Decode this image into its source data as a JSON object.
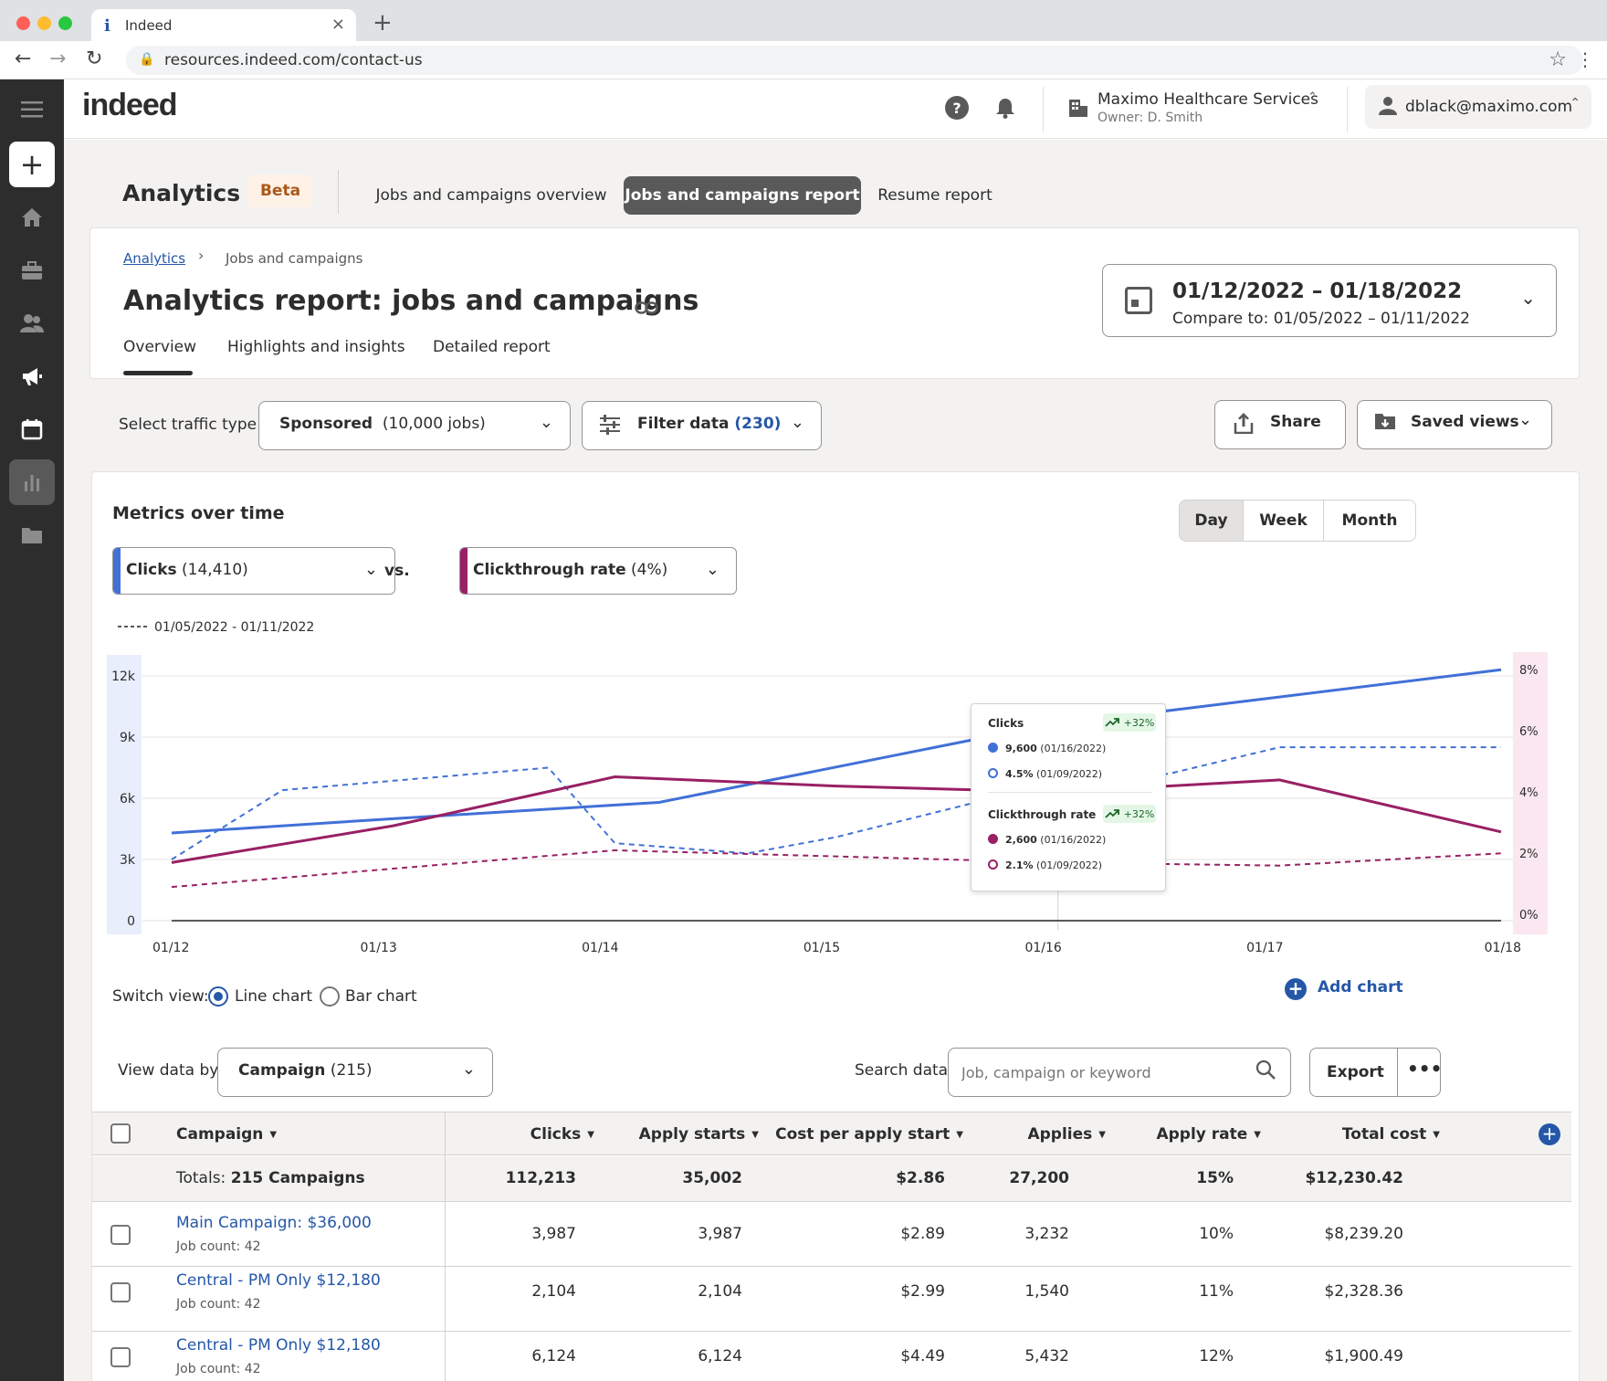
{
  "browser": {
    "tab_title": "Indeed",
    "url": "resources.indeed.com/contact-us"
  },
  "header": {
    "logo": "indeed",
    "company_name": "Maximo Healthcare Services",
    "company_owner": "Owner: D. Smith",
    "user_email": "dblack@maximo.com"
  },
  "analytics_nav": {
    "title": "Analytics",
    "badge": "Beta",
    "tabs": [
      "Jobs and campaigns overview",
      "Jobs and campaigns report",
      "Resume report"
    ],
    "active_tab": "Jobs and campaigns report"
  },
  "report": {
    "breadcrumb_root": "Analytics",
    "breadcrumb_current": "Jobs and campaigns",
    "title": "Analytics report: jobs and campaigns",
    "subtabs": [
      "Overview",
      "Highlights and insights",
      "Detailed report"
    ],
    "active_subtab": "Overview",
    "date_range": "01/12/2022 – 01/18/2022",
    "compare_to": "Compare to: 01/05/2022 – 01/11/2022"
  },
  "filters": {
    "traffic_label": "Select traffic type:",
    "traffic_value": "Sponsored",
    "traffic_count": "(10,000 jobs)",
    "filter_label": "Filter data",
    "filter_count": "(230)",
    "share_label": "Share",
    "saved_views_label": "Saved views"
  },
  "metrics": {
    "title": "Metrics over time",
    "periods": [
      "Day",
      "Week",
      "Month"
    ],
    "selected_period": "Day",
    "metric_a": "Clicks",
    "metric_a_count": "(14,410)",
    "vs_label": "vs.",
    "metric_b": "Clickthrough rate",
    "metric_b_count": "(4%)",
    "compare_legend": "01/05/2022 - 01/11/2022",
    "colors": {
      "clicks": "#4170d7",
      "ctr": "#982065",
      "left_band": "#e8eefb",
      "right_band": "#fbe7f0"
    }
  },
  "tooltip": {
    "clicks_title": "Clicks",
    "clicks_badge": "+32%",
    "clicks_current_value": "9,600",
    "clicks_current_date": "(01/16/2022)",
    "clicks_prev_value": "4.5%",
    "clicks_prev_date": "(01/09/2022)",
    "ctr_title": "Clickthrough rate",
    "ctr_badge": "+32%",
    "ctr_current_value": "2,600",
    "ctr_current_date": "(01/16/2022)",
    "ctr_prev_value": "2.1%",
    "ctr_prev_date": "(01/09/2022)"
  },
  "chart_data": {
    "type": "line",
    "x": [
      "01/12",
      "01/13",
      "01/14",
      "01/15",
      "01/16",
      "01/17",
      "01/18"
    ],
    "y_left_ticks": [
      "12k",
      "9k",
      "6k",
      "3k",
      "0"
    ],
    "y_right_ticks": [
      "8%",
      "6%",
      "4%",
      "2%",
      "0%"
    ],
    "ylim_left": [
      0,
      12000
    ],
    "ylim_right": [
      0,
      8
    ],
    "series": [
      {
        "name": "Clicks",
        "axis": "left",
        "style": "solid",
        "x": [
          0,
          1,
          2.2,
          4,
          4.5,
          6
        ],
        "values": [
          4300,
          5000,
          5800,
          9700,
          10300,
          12300
        ]
      },
      {
        "name": "Clicks",
        "axis": "left",
        "style": "dashed",
        "x": [
          0,
          0.5,
          1.7,
          2,
          2.6,
          3,
          4,
          4.5,
          5,
          6
        ],
        "values": [
          3000,
          6400,
          7500,
          3800,
          3300,
          4100,
          6800,
          7200,
          8500,
          8500
        ]
      },
      {
        "name": "Clickthrough rate",
        "axis": "right",
        "style": "solid",
        "x": [
          0,
          1,
          2,
          3,
          4,
          5,
          6
        ],
        "values": [
          1.9,
          3.1,
          4.7,
          4.4,
          4.2,
          4.6,
          2.9
        ]
      },
      {
        "name": "Clickthrough rate",
        "axis": "right",
        "style": "dashed",
        "x": [
          0,
          1,
          2,
          3,
          4,
          5,
          6
        ],
        "values": [
          1.1,
          1.7,
          2.3,
          2.1,
          1.9,
          1.8,
          2.2
        ]
      },
      {
        "name": "",
        "axis": "left",
        "style": "solid-gray",
        "x": [
          0,
          6
        ],
        "values": [
          0,
          0
        ]
      }
    ],
    "grid": true,
    "hover_x_index": 4
  },
  "view_controls": {
    "switch_label": "Switch view:",
    "line_chart": "Line chart",
    "bar_chart": "Bar chart",
    "selected_view": "Line chart",
    "add_chart": "Add chart",
    "view_by_label": "View data by:",
    "view_by_value": "Campaign",
    "view_by_count": "(215)",
    "search_label": "Search data:",
    "search_placeholder": "Job, campaign or keyword",
    "export_label": "Export"
  },
  "table": {
    "columns": [
      "Campaign",
      "Clicks",
      "Apply starts",
      "Cost per apply start",
      "Applies",
      "Apply rate",
      "Total cost"
    ],
    "totals_label": "Totals:",
    "totals_campaigns": "215 Campaigns",
    "totals": [
      "112,213",
      "35,002",
      "$2.86",
      "27,200",
      "15%",
      "$12,230.42"
    ],
    "rows": [
      {
        "name": "Main Campaign: $36,000",
        "job_count": "Job count: 42",
        "values": [
          "3,987",
          "3,987",
          "$2.89",
          "3,232",
          "10%",
          "$8,239.20"
        ]
      },
      {
        "name": "Central - PM Only $12,180",
        "job_count": "Job count: 42",
        "values": [
          "2,104",
          "2,104",
          "$2.99",
          "1,540",
          "11%",
          "$2,328.36"
        ]
      },
      {
        "name": "Central - PM Only $12,180",
        "job_count": "Job count: 42",
        "values": [
          "6,124",
          "6,124",
          "$4.49",
          "5,432",
          "12%",
          "$1,900.49"
        ]
      }
    ]
  }
}
